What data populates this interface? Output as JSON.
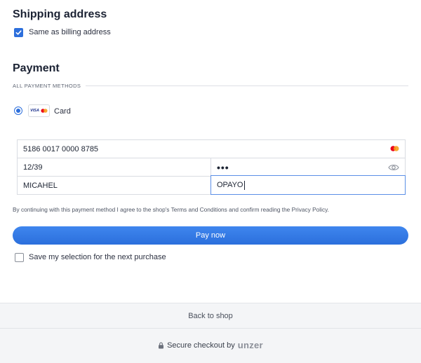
{
  "shipping": {
    "title": "Shipping address",
    "same_as_billing_label": "Same as billing address",
    "same_as_billing_checked": true
  },
  "payment": {
    "title": "Payment",
    "methods_label": "ALL PAYMENT METHODS",
    "selected_method": "Card",
    "card_logo_text": "VISA",
    "method_label": "Card"
  },
  "card_form": {
    "card_number": "5186 0017 0000 8785",
    "expiry": "12/39",
    "cvc_masked": "•••",
    "first_name": "MICAHEL",
    "last_name": "OPAYO"
  },
  "terms_text": "By continuing with this payment method I agree to the shop's Terms and Conditions and confirm reading the Privacy Policy.",
  "pay_button_label": "Pay now",
  "save_selection_label": "Save my selection for the next purchase",
  "footer": {
    "back_label": "Back to shop",
    "secure_label": "Secure checkout by",
    "brand": "unzer"
  },
  "colors": {
    "accent": "#2d6fdc",
    "mastercard_red": "#eb001b",
    "mastercard_orange": "#f79e1b"
  }
}
